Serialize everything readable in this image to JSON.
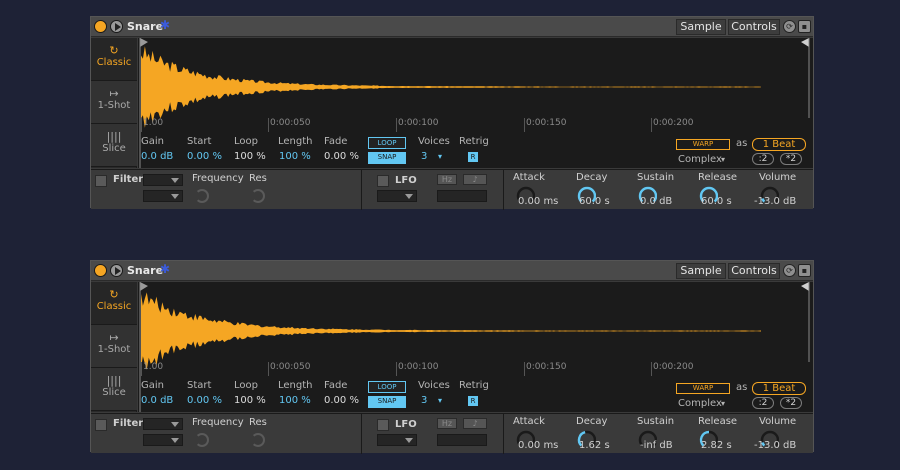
{
  "colors": {
    "accent": "#f5a623",
    "blue": "#62c7f2",
    "background": "#1e2236",
    "waveform": "#f5a623"
  },
  "devices": [
    {
      "title": "Snare",
      "title_icon": "snowflake-icon",
      "tabs": {
        "sample": "Sample",
        "controls": "Controls"
      },
      "modes": [
        {
          "label": "Classic",
          "icon": "loop-icon"
        },
        {
          "label": "1-Shot",
          "icon": "arrow-icon"
        },
        {
          "label": "Slice",
          "icon": "slice-icon"
        }
      ],
      "timeline": [
        "1.00",
        "0:00:050",
        "0:00:100",
        "0:00:150",
        "0:00:200"
      ],
      "labels": {
        "gain": "Gain",
        "start": "Start",
        "loop": "Loop",
        "length": "Length",
        "fade": "Fade",
        "voices": "Voices",
        "retrig": "Retrig"
      },
      "values": {
        "gain": "0.0 dB",
        "start": "0.00 %",
        "loop": "100 %",
        "length": "100 %",
        "fade": "0.00 %",
        "voices": "3"
      },
      "buttons": {
        "loop": "LOOP",
        "snap": "SNAP",
        "retrig": "R",
        "warp": "WARP",
        "as": "as",
        "beat": "1 Beat",
        "warp_mode": "Complex",
        "half": ":2",
        "double": "*2"
      },
      "filter": {
        "label": "Filter",
        "frequency": "Frequency",
        "res": "Res"
      },
      "lfo": {
        "label": "LFO",
        "hz": "Hz",
        "note": "♪"
      },
      "envelope": [
        {
          "label": "Attack",
          "value": "0.00 ms",
          "level": 0.0
        },
        {
          "label": "Decay",
          "value": "60.0 s",
          "level": 1.0
        },
        {
          "label": "Sustain",
          "value": "0.0 dB",
          "level": 1.0
        },
        {
          "label": "Release",
          "value": "60.0 s",
          "level": 1.0
        },
        {
          "label": "Volume",
          "value": "-13.0 dB",
          "level": 0.1
        }
      ]
    },
    {
      "title": "Snare",
      "title_icon": "snowflake-icon",
      "tabs": {
        "sample": "Sample",
        "controls": "Controls"
      },
      "modes": [
        {
          "label": "Classic",
          "icon": "loop-icon"
        },
        {
          "label": "1-Shot",
          "icon": "arrow-icon"
        },
        {
          "label": "Slice",
          "icon": "slice-icon"
        }
      ],
      "timeline": [
        "1.00",
        "0:00:050",
        "0:00:100",
        "0:00:150",
        "0:00:200"
      ],
      "labels": {
        "gain": "Gain",
        "start": "Start",
        "loop": "Loop",
        "length": "Length",
        "fade": "Fade",
        "voices": "Voices",
        "retrig": "Retrig"
      },
      "values": {
        "gain": "0.0 dB",
        "start": "0.00 %",
        "loop": "100 %",
        "length": "100 %",
        "fade": "0.00 %",
        "voices": "3"
      },
      "buttons": {
        "loop": "LOOP",
        "snap": "SNAP",
        "retrig": "R",
        "warp": "WARP",
        "as": "as",
        "beat": "1 Beat",
        "warp_mode": "Complex",
        "half": ":2",
        "double": "*2"
      },
      "filter": {
        "label": "Filter",
        "frequency": "Frequency",
        "res": "Res"
      },
      "lfo": {
        "label": "LFO",
        "hz": "Hz",
        "note": "♪"
      },
      "envelope": [
        {
          "label": "Attack",
          "value": "0.00 ms",
          "level": 0.0
        },
        {
          "label": "Decay",
          "value": "1.62 s",
          "level": 0.45
        },
        {
          "label": "Sustain",
          "value": "-inf dB",
          "level": 0.0
        },
        {
          "label": "Release",
          "value": "2.82 s",
          "level": 0.5
        },
        {
          "label": "Volume",
          "value": "-13.0 dB",
          "level": 0.1
        }
      ]
    }
  ]
}
